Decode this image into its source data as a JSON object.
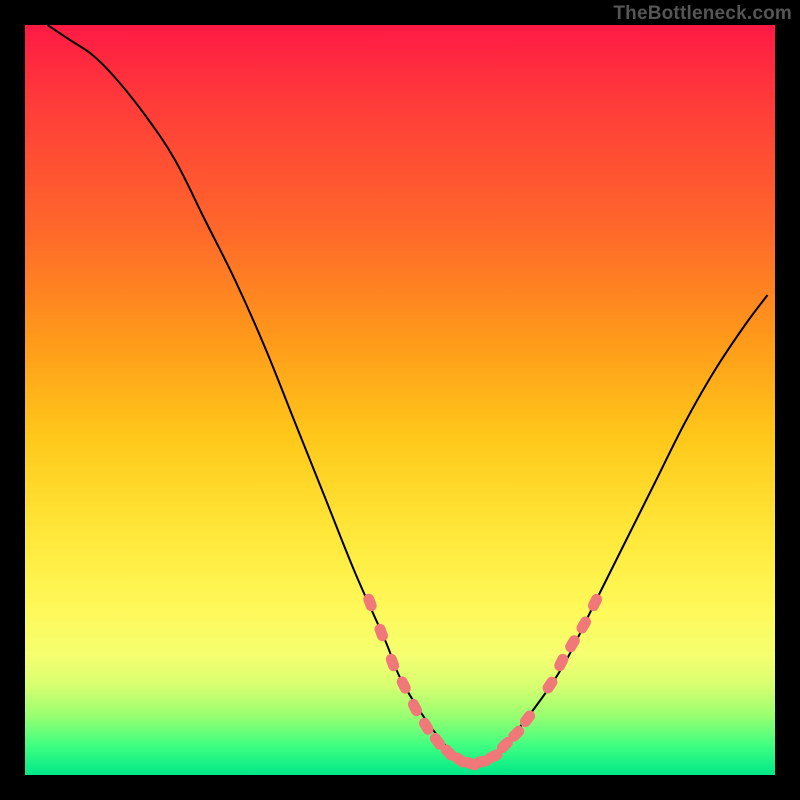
{
  "watermark": "TheBottleneck.com",
  "chart_data": {
    "type": "line",
    "title": "",
    "xlabel": "",
    "ylabel": "",
    "xlim": [
      0,
      100
    ],
    "ylim": [
      0,
      100
    ],
    "grid": false,
    "legend": false,
    "series": [
      {
        "name": "curve",
        "stroke": "#000000",
        "stroke_width": 2,
        "x": [
          3,
          6,
          9,
          12,
          16,
          20,
          24,
          28,
          32,
          36,
          40,
          44,
          48,
          50,
          53,
          56,
          58,
          60,
          62,
          64,
          68,
          72,
          76,
          80,
          84,
          88,
          92,
          96,
          99
        ],
        "y": [
          100,
          98,
          96,
          93,
          88,
          82,
          74,
          66,
          57,
          47,
          37,
          27,
          18,
          13,
          8,
          4,
          2,
          1,
          2,
          4,
          9,
          15,
          23,
          31,
          39,
          47,
          54,
          60,
          64
        ]
      }
    ],
    "markers": [
      {
        "name": "dots",
        "shape": "rounded-capsule",
        "fill": "#f07878",
        "points": [
          {
            "x": 46,
            "y": 23
          },
          {
            "x": 47.5,
            "y": 19
          },
          {
            "x": 49,
            "y": 15
          },
          {
            "x": 50.5,
            "y": 12
          },
          {
            "x": 52,
            "y": 9
          },
          {
            "x": 53.5,
            "y": 6.5
          },
          {
            "x": 55,
            "y": 4.5
          },
          {
            "x": 56.5,
            "y": 3
          },
          {
            "x": 58,
            "y": 2
          },
          {
            "x": 59.5,
            "y": 1.5
          },
          {
            "x": 61,
            "y": 1.8
          },
          {
            "x": 62.5,
            "y": 2.5
          },
          {
            "x": 64,
            "y": 4
          },
          {
            "x": 65.5,
            "y": 5.5
          },
          {
            "x": 67,
            "y": 7.5
          },
          {
            "x": 70,
            "y": 12
          },
          {
            "x": 71.5,
            "y": 15
          },
          {
            "x": 73,
            "y": 17.5
          },
          {
            "x": 74.5,
            "y": 20
          },
          {
            "x": 76,
            "y": 23
          }
        ]
      }
    ]
  }
}
